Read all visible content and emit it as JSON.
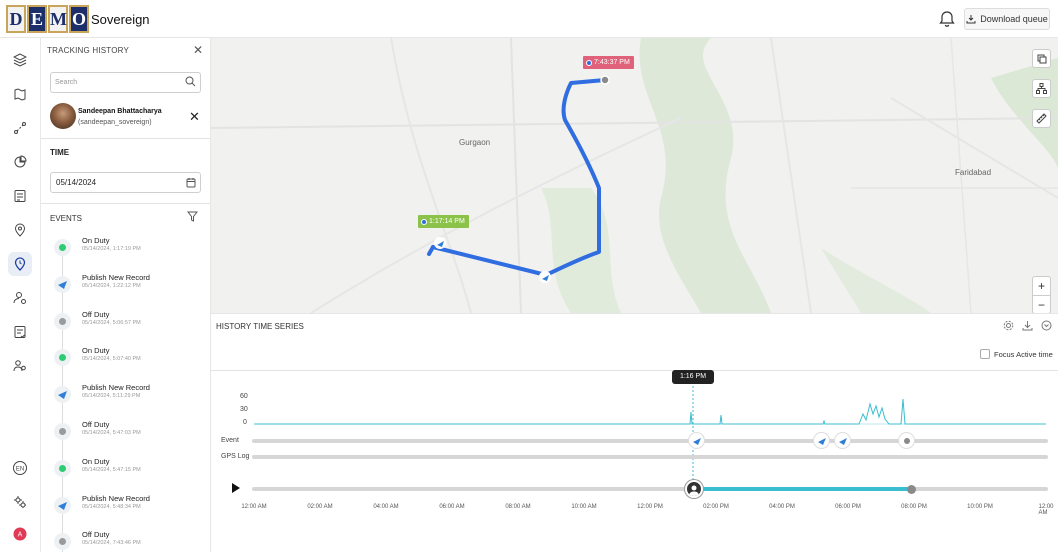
{
  "app": {
    "logo_letters": [
      "D",
      "E",
      "M",
      "O"
    ],
    "brand": "Sovereign",
    "download_queue": "Download queue"
  },
  "panel": {
    "title": "TRACKING HISTORY",
    "search_placeholder": "Search",
    "user_name": "Sandeepan Bhattacharya",
    "user_handle": "(sandeepan_sovereign)",
    "time_label": "TIME",
    "date": "05/14/2024",
    "events_label": "EVENTS",
    "events": [
      {
        "title": "On Duty",
        "date": "05/14/2024, 1:17:19 PM",
        "kind": "duty",
        "color": "#2ecc71"
      },
      {
        "title": "Publish New Record",
        "date": "05/14/2024, 1:22:12 PM",
        "kind": "publish",
        "color": "#2f7fd8"
      },
      {
        "title": "Off Duty",
        "date": "05/14/2024, 5:06:57 PM",
        "kind": "off",
        "color": "#9a9a9a"
      },
      {
        "title": "On Duty",
        "date": "05/14/2024, 5:07:40 PM",
        "kind": "duty",
        "color": "#2ecc71"
      },
      {
        "title": "Publish New Record",
        "date": "05/14/2024, 5:11:29 PM",
        "kind": "publish",
        "color": "#2f7fd8"
      },
      {
        "title": "Off Duty",
        "date": "05/14/2024, 5:47:03 PM",
        "kind": "off",
        "color": "#9a9a9a"
      },
      {
        "title": "On Duty",
        "date": "05/14/2024, 5:47:15 PM",
        "kind": "duty",
        "color": "#2ecc71"
      },
      {
        "title": "Publish New Record",
        "date": "05/14/2024, 5:48:34 PM",
        "kind": "publish",
        "color": "#2f7fd8"
      },
      {
        "title": "Off Duty",
        "date": "05/14/2024, 7:43:46 PM",
        "kind": "off",
        "color": "#9a9a9a"
      }
    ]
  },
  "map": {
    "start_time": "1:17:14 PM",
    "end_time": "7:43:37 PM",
    "labels": [
      "Gurgaon",
      "Faridabad"
    ],
    "zoom_in": "+",
    "zoom_out": "−",
    "route_color": "#2f6de1"
  },
  "series": {
    "title": "HISTORY TIME SERIES",
    "focus_label": "Focus Active time",
    "cursor_time": "1:16 PM",
    "y_ticks": [
      "60",
      "30",
      "0"
    ],
    "row_labels": [
      "Event",
      "GPS Log"
    ],
    "x_ticks": [
      "12:00 AM",
      "02:00 AM",
      "04:00 AM",
      "06:00 AM",
      "08:00 AM",
      "10:00 AM",
      "12:00 PM",
      "02:00 PM",
      "04:00 PM",
      "06:00 PM",
      "08:00 PM",
      "10:00 PM",
      "12:00 AM"
    ],
    "accent": "#3bbdd0"
  }
}
